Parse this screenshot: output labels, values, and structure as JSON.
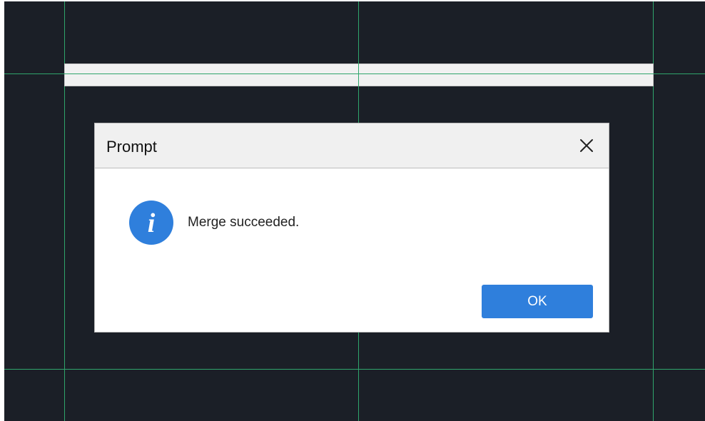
{
  "dialog": {
    "title": "Prompt",
    "message": "Merge succeeded.",
    "ok_label": "OK",
    "close_icon": "close-icon",
    "info_icon": "info-icon"
  },
  "colors": {
    "canvas_background": "#1b1f27",
    "grid_line": "#2fa56c",
    "dialog_titlebar": "#f0f0f0",
    "ok_button": "#2f7fdc",
    "info_icon": "#2f7fdc"
  }
}
